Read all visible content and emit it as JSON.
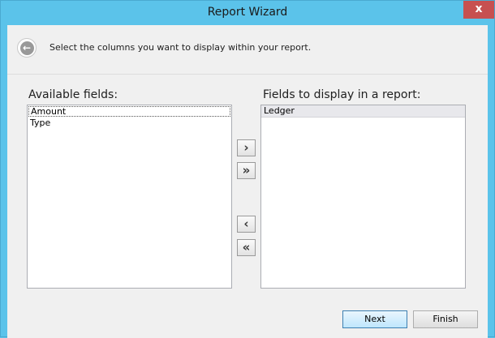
{
  "window": {
    "title": "Report Wizard",
    "close_glyph": "x"
  },
  "header": {
    "back_icon": "arrow-left-icon",
    "back_glyph": "←",
    "instruction": "Select the columns you want to display within your report."
  },
  "available": {
    "label": "Available fields:",
    "items": [
      "Amount",
      "Type"
    ]
  },
  "display": {
    "label": "Fields to display in a report:",
    "items": [
      "Ledger"
    ]
  },
  "move_buttons": {
    "add": "›",
    "add_all": "»",
    "remove": "‹",
    "remove_all": "«"
  },
  "footer": {
    "next_label": "Next",
    "finish_label": "Finish"
  }
}
